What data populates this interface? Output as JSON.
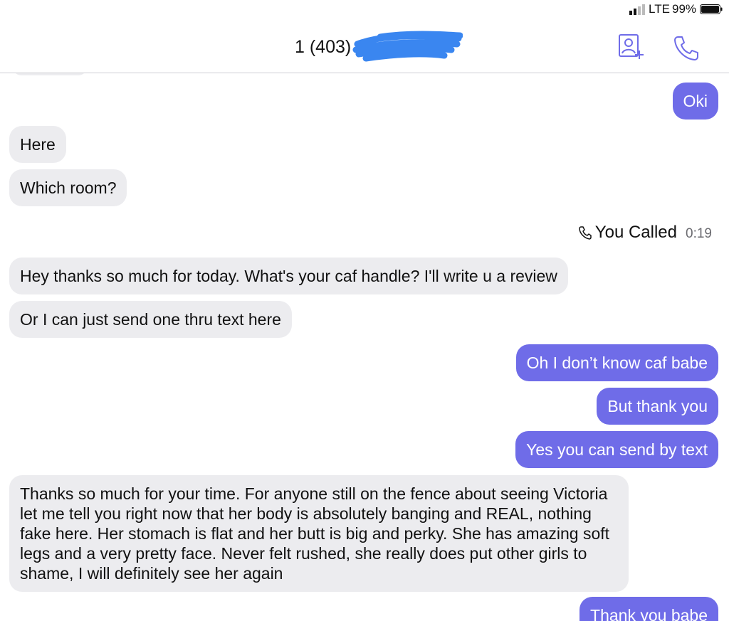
{
  "status_bar": {
    "network": "LTE",
    "battery": "99%"
  },
  "header": {
    "title": "1 (403) 6"
  },
  "messages": {
    "m1": "Oki",
    "m2": "Here",
    "m3": "Which room?",
    "m5": "Hey thanks so much for today. What's your caf handle? I'll write u a review",
    "m6": "Or I can just send one thru text here",
    "m7": "Oh I don’t know caf babe",
    "m8": "But thank you",
    "m9": "Yes you can send by text",
    "m10": "Thanks so much for your time. For anyone still on the fence about seeing Victoria let me tell you right now that her body is absolutely banging and REAL, nothing fake here. Her stomach is flat and her butt is big and perky. She has amazing soft legs and a very pretty face. Never felt rushed, she really does put other girls to shame, I will definitely see her again",
    "m11": "Thank you babe"
  },
  "call_log": {
    "label": "You Called",
    "duration": "0:19"
  },
  "colors": {
    "outgoing": "#6f6ce8",
    "incoming": "#ececef",
    "redaction": "#3a86f0"
  }
}
